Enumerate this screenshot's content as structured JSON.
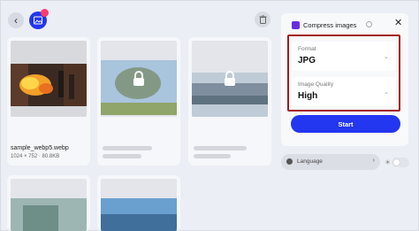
{
  "toolbar": {
    "back_icon": "chevron-left-icon",
    "gallery_icon": "image-icon",
    "gallery_badge": "",
    "trash_icon": "trash-icon"
  },
  "files": [
    {
      "name": "sample_webp5.webp",
      "meta": "1024 × 752 · 80.8KB",
      "locked": false
    },
    {
      "name": "",
      "meta": "",
      "locked": true
    },
    {
      "name": "",
      "meta": "",
      "locked": true
    },
    {
      "name": "",
      "meta": "",
      "locked": true
    },
    {
      "name": "",
      "meta": "",
      "locked": true
    }
  ],
  "panel": {
    "title": "Compress images",
    "format_label": "Format",
    "format_value": "JPG",
    "quality_label": "Image Quality",
    "quality_value": "High",
    "start_label": "Start"
  },
  "footer": {
    "language_label": "Language"
  },
  "colors": {
    "accent": "#2336f0",
    "highlight_border": "#a21b1b",
    "panel_icon": "#6a2ee0"
  }
}
